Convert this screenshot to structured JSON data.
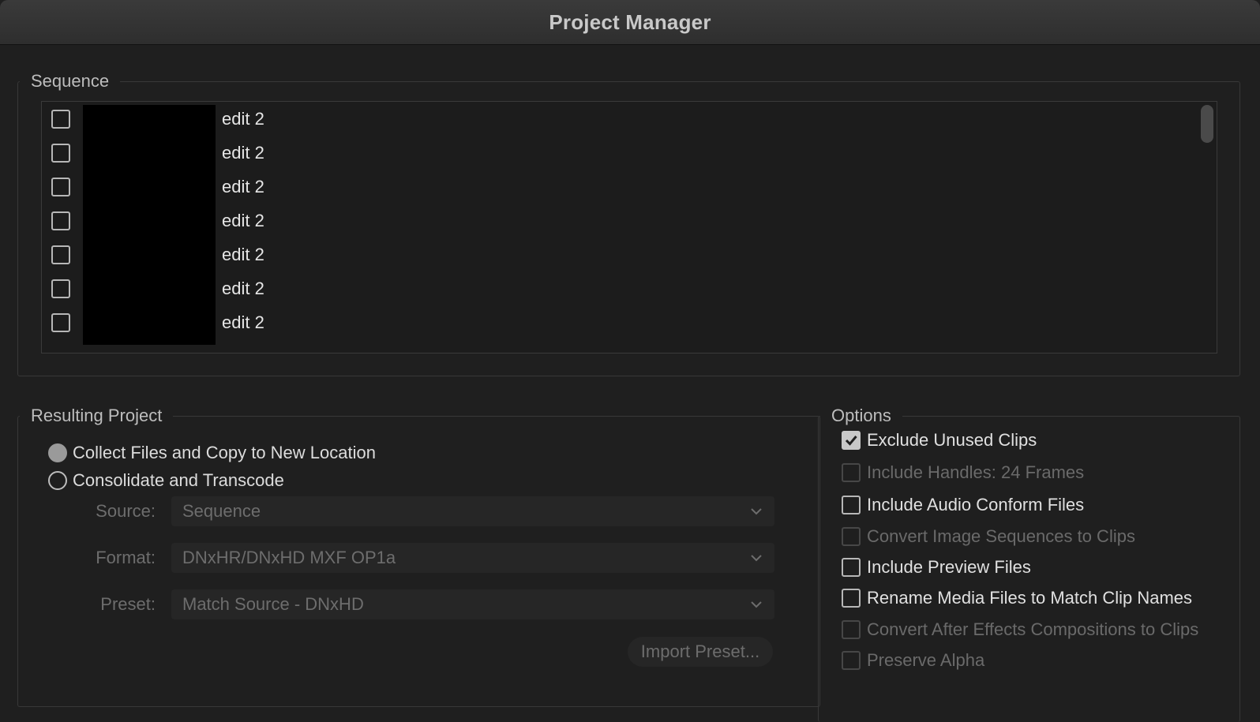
{
  "window": {
    "title": "Project Manager"
  },
  "sequence": {
    "label": "Sequence",
    "items": [
      {
        "name": "edit 2",
        "checked": false
      },
      {
        "name": "edit 2",
        "checked": false
      },
      {
        "name": "edit 2",
        "checked": false
      },
      {
        "name": "edit 2",
        "checked": false
      },
      {
        "name": "edit 2",
        "checked": false
      },
      {
        "name": "edit 2",
        "checked": false
      },
      {
        "name": "edit 2",
        "checked": false
      }
    ]
  },
  "resulting_project": {
    "label": "Resulting Project",
    "options": [
      {
        "label": "Collect Files and Copy to New Location",
        "selected": true
      },
      {
        "label": "Consolidate and Transcode",
        "selected": false
      }
    ],
    "source": {
      "label": "Source:",
      "value": "Sequence"
    },
    "format": {
      "label": "Format:",
      "value": "DNxHR/DNxHD MXF OP1a"
    },
    "preset": {
      "label": "Preset:",
      "value": "Match Source - DNxHD"
    },
    "import_preset_label": "Import Preset..."
  },
  "options": {
    "label": "Options",
    "items": [
      {
        "label": "Exclude Unused Clips",
        "checked": true,
        "enabled": true
      },
      {
        "label": "Include Handles:  24 Frames",
        "checked": false,
        "enabled": false
      },
      {
        "label": "Include Audio Conform Files",
        "checked": false,
        "enabled": true
      },
      {
        "label": "Convert Image Sequences to Clips",
        "checked": false,
        "enabled": false
      },
      {
        "label": "Include Preview Files",
        "checked": false,
        "enabled": true
      },
      {
        "label": "Rename Media Files to Match Clip Names",
        "checked": false,
        "enabled": true
      },
      {
        "label": "Convert After Effects Compositions to Clips",
        "checked": false,
        "enabled": false
      },
      {
        "label": "Preserve Alpha",
        "checked": false,
        "enabled": false
      }
    ]
  },
  "colors": {
    "background": "#1f1f1f",
    "titlebar": "#333333",
    "text": "#e0e0e0",
    "disabled_text": "#6a6a6a"
  }
}
